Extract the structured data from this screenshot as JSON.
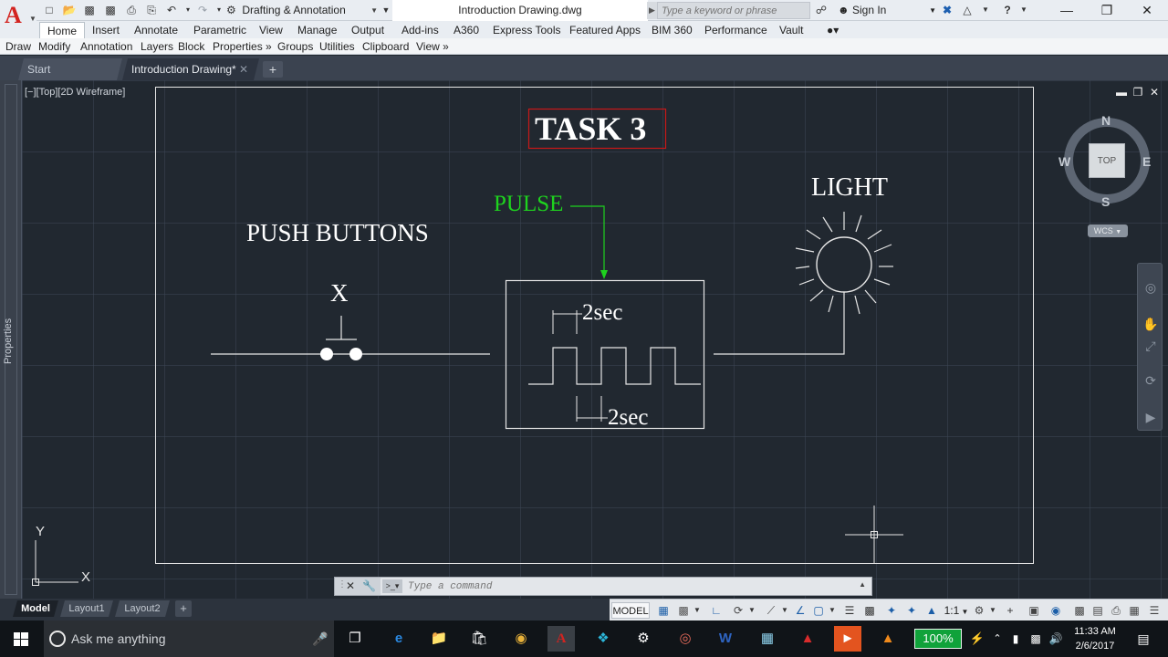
{
  "app": {
    "logo_letter": "A",
    "workspace": "Drafting & Annotation",
    "document_title": "Introduction Drawing.dwg",
    "search_placeholder": "Type a keyword or phrase",
    "sign_in": "Sign In"
  },
  "ribbon": {
    "tabs": [
      {
        "label": "Home",
        "active": true
      },
      {
        "label": "Insert"
      },
      {
        "label": "Annotate"
      },
      {
        "label": "Parametric"
      },
      {
        "label": "View"
      },
      {
        "label": "Manage"
      },
      {
        "label": "Output"
      },
      {
        "label": "Add-ins"
      },
      {
        "label": "A360"
      },
      {
        "label": "Express Tools"
      },
      {
        "label": "Featured Apps"
      },
      {
        "label": "BIM 360"
      },
      {
        "label": "Performance"
      },
      {
        "label": "Vault"
      }
    ],
    "panels": [
      "Draw",
      "Modify",
      "Annotation",
      "Layers",
      "Block",
      "Properties »",
      "Groups",
      "Utilities",
      "Clipboard",
      "View »"
    ]
  },
  "file_tabs": {
    "start": "Start",
    "active_doc": "Introduction Drawing*"
  },
  "palette": {
    "properties_label": "Properties"
  },
  "viewport": {
    "controls": "[−][Top][2D Wireframe]"
  },
  "drawing": {
    "title": "TASK 3",
    "pulse_label": "PULSE",
    "push_buttons_label": "PUSH BUTTONS",
    "button_label": "X",
    "light_label": "LIGHT",
    "time_top": "2sec",
    "time_bottom": "2sec"
  },
  "viewcube": {
    "north": "N",
    "south": "S",
    "east": "E",
    "west": "W",
    "face": "TOP",
    "wcs": "WCS"
  },
  "ucs": {
    "x": "X",
    "y": "Y"
  },
  "command_line": {
    "placeholder": "Type a command"
  },
  "layout_tabs": [
    "Model",
    "Layout1",
    "Layout2"
  ],
  "status_bar": {
    "model": "MODEL",
    "scale": "1:1"
  },
  "taskbar": {
    "search_placeholder": "Ask me anything",
    "battery_percent": "100%",
    "time": "11:33 AM",
    "date": "2/6/2017"
  },
  "colors": {
    "canvas_bg": "#212830",
    "autocad_red": "#d32420",
    "pulse_green": "#1ed31e",
    "title_frame_red": "#c81818"
  }
}
